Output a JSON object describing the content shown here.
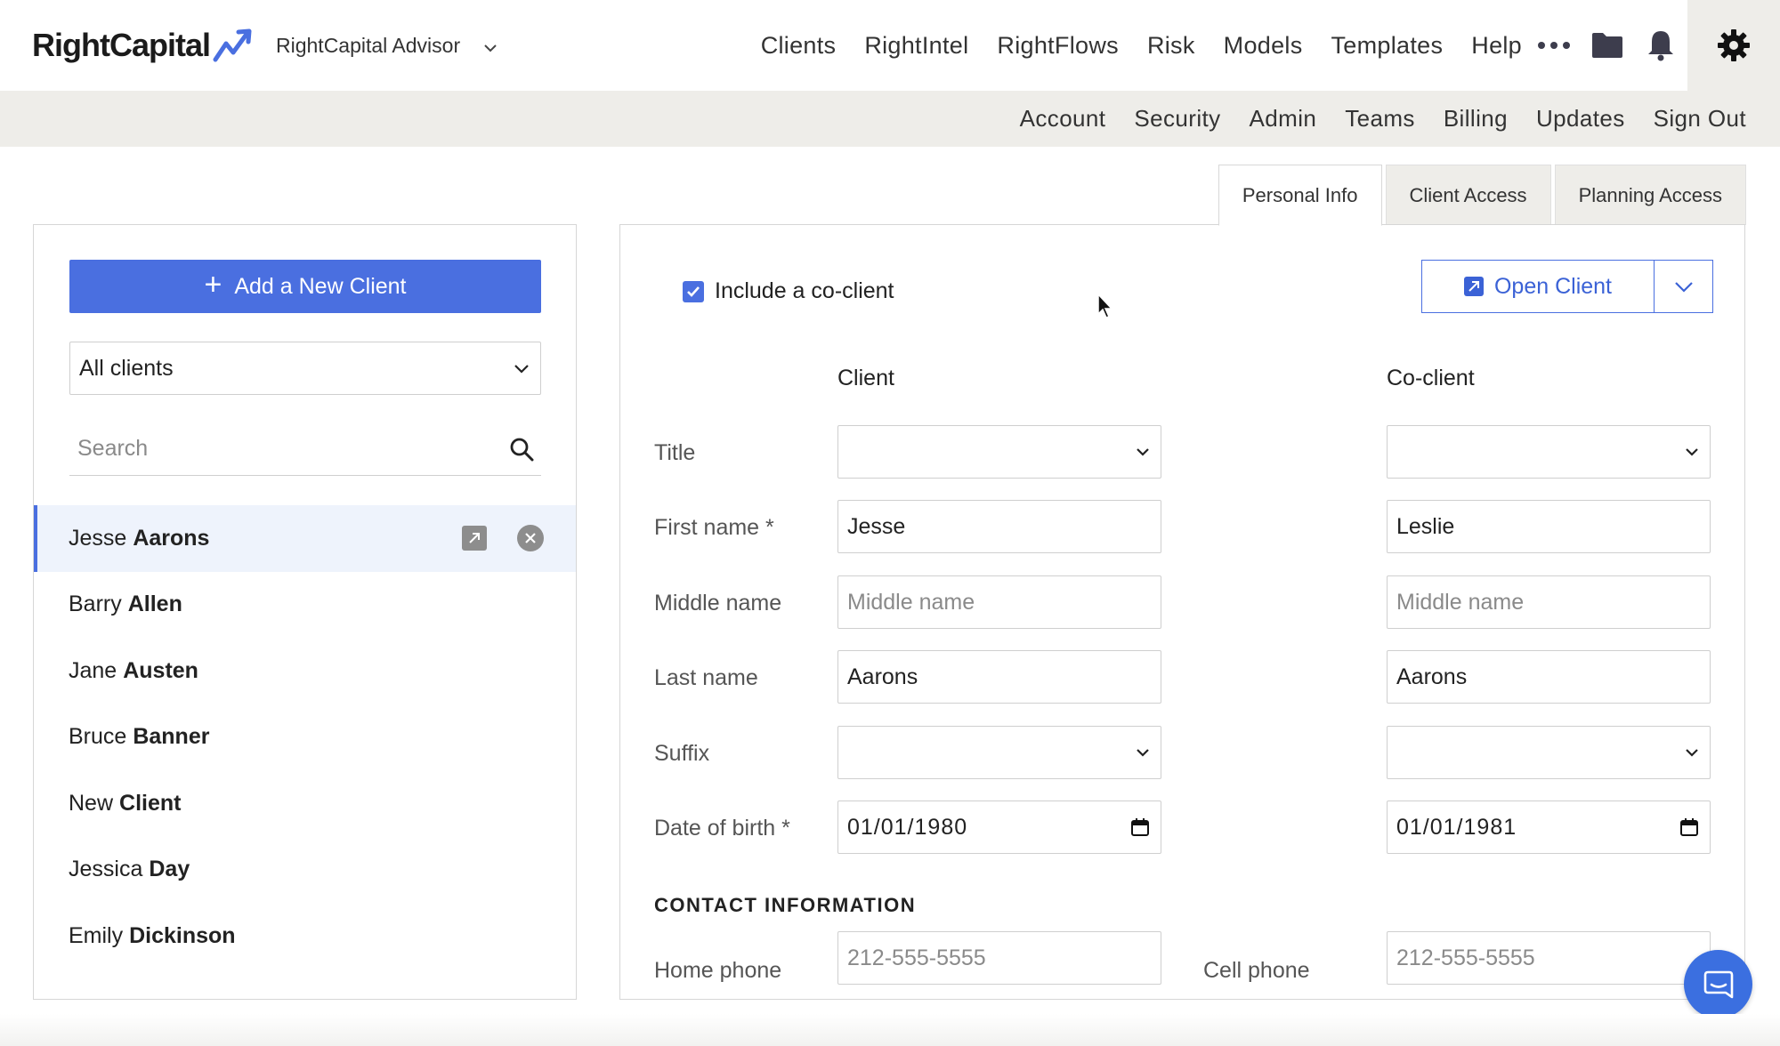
{
  "brand": {
    "name": "RightCapital",
    "accent": "#4a6fe0"
  },
  "advisor": {
    "name": "RightCapital Advisor"
  },
  "main_nav": [
    "Clients",
    "RightIntel",
    "RightFlows",
    "Risk",
    "Models",
    "Templates",
    "Help"
  ],
  "nav_icons": [
    "more-icon",
    "folder-icon",
    "bell-icon",
    "gear-icon"
  ],
  "sub_nav": [
    "Account",
    "Security",
    "Admin",
    "Teams",
    "Billing",
    "Updates",
    "Sign Out"
  ],
  "tabs": [
    {
      "label": "Personal Info",
      "active": true
    },
    {
      "label": "Client Access",
      "active": false
    },
    {
      "label": "Planning Access",
      "active": false
    }
  ],
  "sidebar": {
    "add_label": "Add a New Client",
    "filter_value": "All clients",
    "search_placeholder": "Search",
    "clients": [
      {
        "first": "Jesse",
        "last": "Aarons",
        "selected": true
      },
      {
        "first": "Barry",
        "last": "Allen"
      },
      {
        "first": "Jane",
        "last": "Austen"
      },
      {
        "first": "Bruce",
        "last": "Banner"
      },
      {
        "first": "New",
        "last": "Client"
      },
      {
        "first": "Jessica",
        "last": "Day"
      },
      {
        "first": "Emily",
        "last": "Dickinson"
      }
    ]
  },
  "form": {
    "include_coclient_label": "Include a co-client",
    "include_coclient_checked": true,
    "open_client_label": "Open Client",
    "client_header": "Client",
    "coclient_header": "Co-client",
    "labels": {
      "title": "Title",
      "first_name": "First name *",
      "middle_name": "Middle name",
      "last_name": "Last name",
      "suffix": "Suffix",
      "dob": "Date of birth *"
    },
    "client": {
      "title": "",
      "first_name": "Jesse",
      "middle_placeholder": "Middle name",
      "last_name": "Aarons",
      "suffix": "",
      "dob": "01/01/1980"
    },
    "coclient": {
      "title": "",
      "first_name": "Leslie",
      "middle_placeholder": "Middle name",
      "last_name": "Aarons",
      "suffix": "",
      "dob": "01/01/1981"
    },
    "contact_header": "CONTACT INFORMATION",
    "home_phone_label": "Home phone",
    "home_phone_placeholder": "212-555-5555",
    "cell_phone_label": "Cell phone",
    "cell_phone_placeholder": "212-555-5555"
  }
}
